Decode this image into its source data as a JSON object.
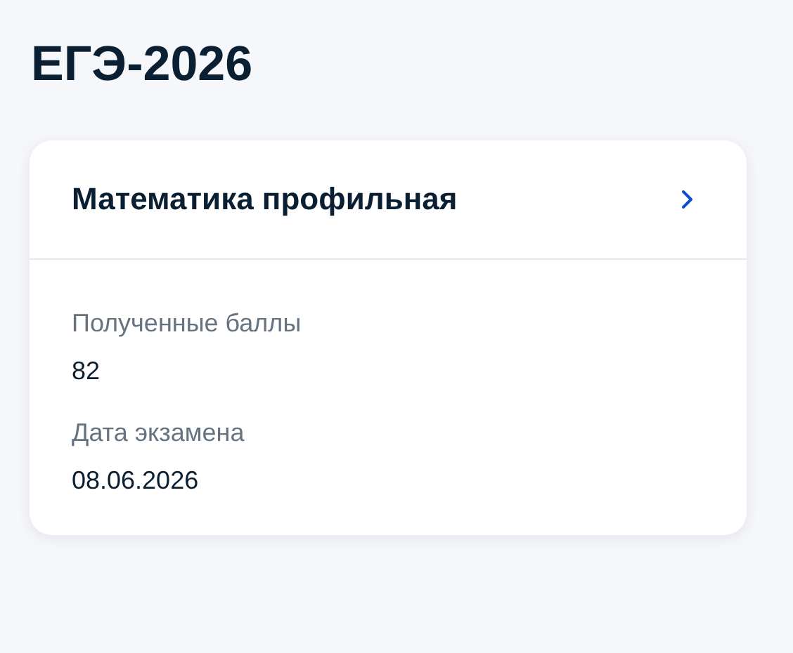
{
  "page_title": "ЕГЭ-2026",
  "card": {
    "title": "Математика профильная",
    "fields": [
      {
        "label": "Полученные баллы",
        "value": "82"
      },
      {
        "label": "Дата экзамена",
        "value": "08.06.2026"
      }
    ]
  }
}
